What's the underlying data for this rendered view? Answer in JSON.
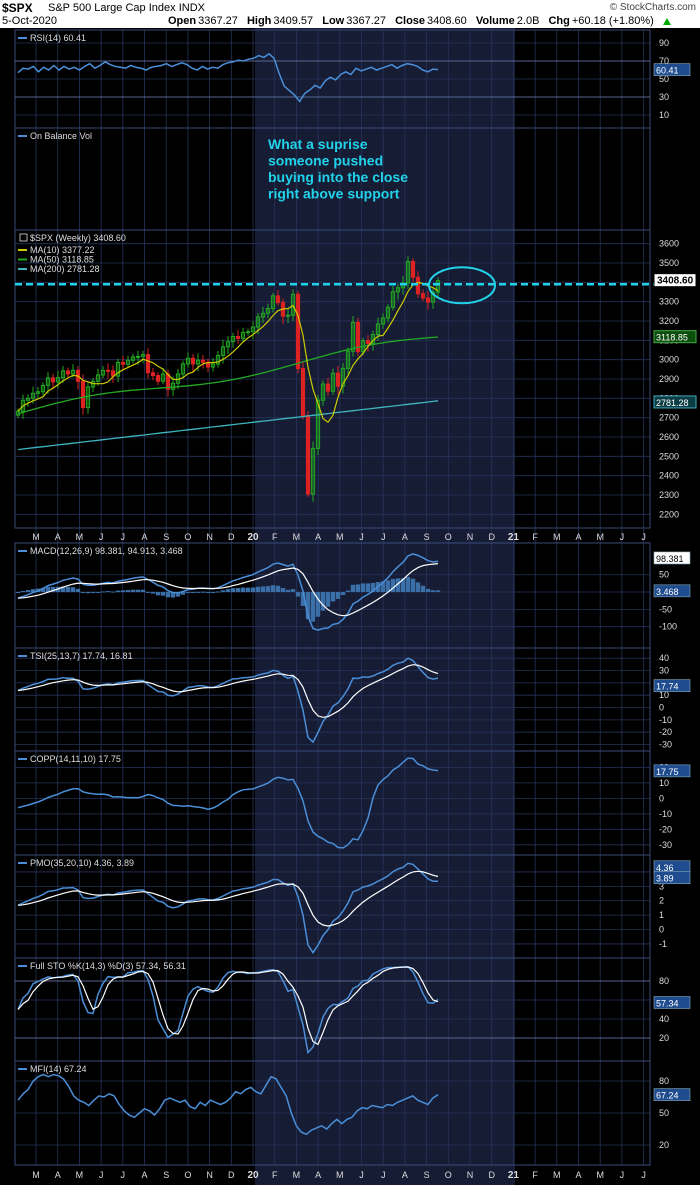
{
  "header": {
    "symbol": "$SPX",
    "name": "S&P 500 Large Cap Index",
    "exchange": "INDX",
    "date": "5-Oct-2020",
    "open_label": "Open",
    "open": "3367.27",
    "high_label": "High",
    "high": "3409.57",
    "low_label": "Low",
    "low": "3367.27",
    "close_label": "Close",
    "close": "3408.60",
    "volume_label": "Volume",
    "volume": "2.0B",
    "chg_label": "Chg",
    "chg": "+60.18 (+1.80%)",
    "credit": "© StockCharts.com"
  },
  "annotation": {
    "lines": [
      "What a suprise",
      "someone pushed",
      "buying into the close",
      "right above support"
    ]
  },
  "colors": {
    "background": "#000000",
    "shade": "#171c35",
    "grid": "#26335a",
    "line_blue": "#4a8fd8",
    "ma10": "#cccc00",
    "ma50": "#22aa22",
    "ma200": "#3fb5c0",
    "up_candle": "#22aa22",
    "down_candle": "#dd2222",
    "support_line": "#21d3ea",
    "text": "#dddddd"
  },
  "chart_data": {
    "type": "line",
    "x_labels": [
      "M",
      "A",
      "M",
      "J",
      "J",
      "A",
      "S",
      "O",
      "N",
      "D",
      "20",
      "F",
      "M",
      "A",
      "M",
      "J",
      "J",
      "A",
      "S",
      "O",
      "N",
      "D",
      "21",
      "F",
      "M",
      "A",
      "M",
      "J",
      "J"
    ],
    "panels": [
      {
        "id": "rsi",
        "legend": "RSI(14) 60.41",
        "ticks": [
          "90",
          "70",
          "50",
          "30",
          "10"
        ],
        "ylim": [
          0,
          100
        ],
        "last_label": "60.41",
        "series": [
          {
            "values": [
              57,
              62,
              61,
              64,
              58,
              63,
              60,
              65,
              60,
              64,
              61,
              63,
              60,
              64,
              67,
              62,
              65,
              69,
              66,
              64,
              63,
              62,
              65,
              63,
              62,
              60,
              63,
              64,
              65,
              67,
              64,
              66,
              68,
              66,
              62,
              60,
              64,
              61,
              63,
              62,
              66,
              68,
              69,
              71,
              70,
              72,
              73,
              76,
              74,
              78,
              73,
              56,
              42,
              37,
              32,
              25,
              34,
              38,
              43,
              40,
              48,
              52,
              49,
              55,
              58,
              55,
              62,
              59,
              61,
              63,
              60,
              62,
              64,
              66,
              62,
              65,
              67,
              66,
              64,
              60,
              58,
              61,
              60.41
            ]
          }
        ]
      },
      {
        "id": "obv",
        "legend": "On Balance Vol",
        "ticks": [],
        "series": []
      },
      {
        "id": "price",
        "legend": "$SPX (Weekly) 3408.60",
        "ticks": [
          "3600",
          "3500",
          "3400",
          "3300",
          "3200",
          "3100",
          "3000",
          "2900",
          "2800",
          "2700",
          "2600",
          "2500",
          "2400",
          "2300",
          "2200"
        ],
        "ylim": [
          2150,
          3650
        ],
        "last_label": "3408.60",
        "label_ma50": "3118.85",
        "label_ma200": "2781.28",
        "legend_ma10": "MA(10) 3377.22",
        "legend_ma50": "MA(50) 3118.85",
        "legend_ma200": "MA(200) 2781.28",
        "support_level": 3390,
        "closes": [
          2733,
          2790,
          2801,
          2826,
          2834,
          2867,
          2906,
          2885,
          2907,
          2942,
          2926,
          2945,
          2888,
          2752,
          2859,
          2888,
          2921,
          2945,
          2942,
          2915,
          2986,
          2976,
          2997,
          3014,
          3017,
          3026,
          2932,
          2918,
          2888,
          2926,
          2847,
          2878,
          2926,
          2978,
          3007,
          2978,
          2997,
          2987,
          2962,
          2977,
          3022,
          3066,
          3093,
          3120,
          3110,
          3141,
          3145,
          3169,
          3221,
          3240,
          3265,
          3330,
          3295,
          3225,
          3230,
          3338,
          2954,
          2711,
          2305,
          2541,
          2790,
          2874,
          2837,
          2930,
          2863,
          2955,
          3044,
          3193,
          3041,
          3098,
          3083,
          3130,
          3185,
          3215,
          3271,
          3351,
          3372,
          3397,
          3508,
          3426,
          3341,
          3319,
          3298,
          3349,
          3408.6
        ]
      },
      {
        "id": "macd",
        "legend": "MACD(12,26,9) 98.381, 94.913, 3.468",
        "ticks": [
          "50",
          "0",
          "-50",
          "-100"
        ],
        "ylim": [
          -150,
          130
        ],
        "last_label": "98.381",
        "hist_label": "3.468"
      },
      {
        "id": "tsi",
        "legend": "TSI(25,13,7) 17.74, 16.81",
        "ticks": [
          "40",
          "30",
          "20",
          "10",
          "0",
          "-10",
          "-20",
          "-30"
        ],
        "ylim": [
          -32,
          45
        ],
        "last_label": "17.74"
      },
      {
        "id": "copp",
        "legend": "COPP(14,11,10) 17.75",
        "ticks": [
          "20",
          "10",
          "0",
          "-10",
          "-20",
          "-30"
        ],
        "ylim": [
          -34,
          28
        ],
        "last_label": "17.75"
      },
      {
        "id": "pmo",
        "legend": "PMO(35,20,10) 4.36, 3.89",
        "ticks": [
          "4",
          "3",
          "2",
          "1",
          "0",
          "-1"
        ],
        "ylim": [
          -1.7,
          4.9
        ],
        "last_label": "4.36",
        "signal_label": "3.89"
      },
      {
        "id": "sto",
        "legend": "Full STO %K(14,3) %D(3) 57.34, 56.31",
        "ticks": [
          "80",
          "60",
          "40",
          "20"
        ],
        "ylim": [
          0,
          100
        ],
        "last_label": "57.34"
      },
      {
        "id": "mfi",
        "legend": "MFI(14) 67.24",
        "ticks": [
          "80",
          "50",
          "20"
        ],
        "ylim": [
          5,
          95
        ],
        "last_label": "67.24",
        "series": [
          {
            "values": [
              62,
              68,
              72,
              80,
              84,
              86,
              84,
              86,
              85,
              82,
              75,
              66,
              62,
              60,
              57,
              62,
              66,
              65,
              68,
              66,
              58,
              52,
              48,
              46,
              50,
              54,
              52,
              48,
              54,
              62,
              64,
              62,
              60,
              62,
              56,
              54,
              60,
              57,
              62,
              60,
              58,
              60,
              64,
              70,
              68,
              72,
              74,
              70,
              68,
              76,
              84,
              82,
              74,
              66,
              50,
              38,
              32,
              30,
              34,
              36,
              38,
              35,
              40,
              44,
              40,
              44,
              46,
              52,
              55,
              54,
              57,
              56,
              55,
              58,
              57,
              60,
              62,
              64,
              66,
              62,
              60,
              58,
              64,
              67.24
            ]
          }
        ]
      }
    ]
  }
}
